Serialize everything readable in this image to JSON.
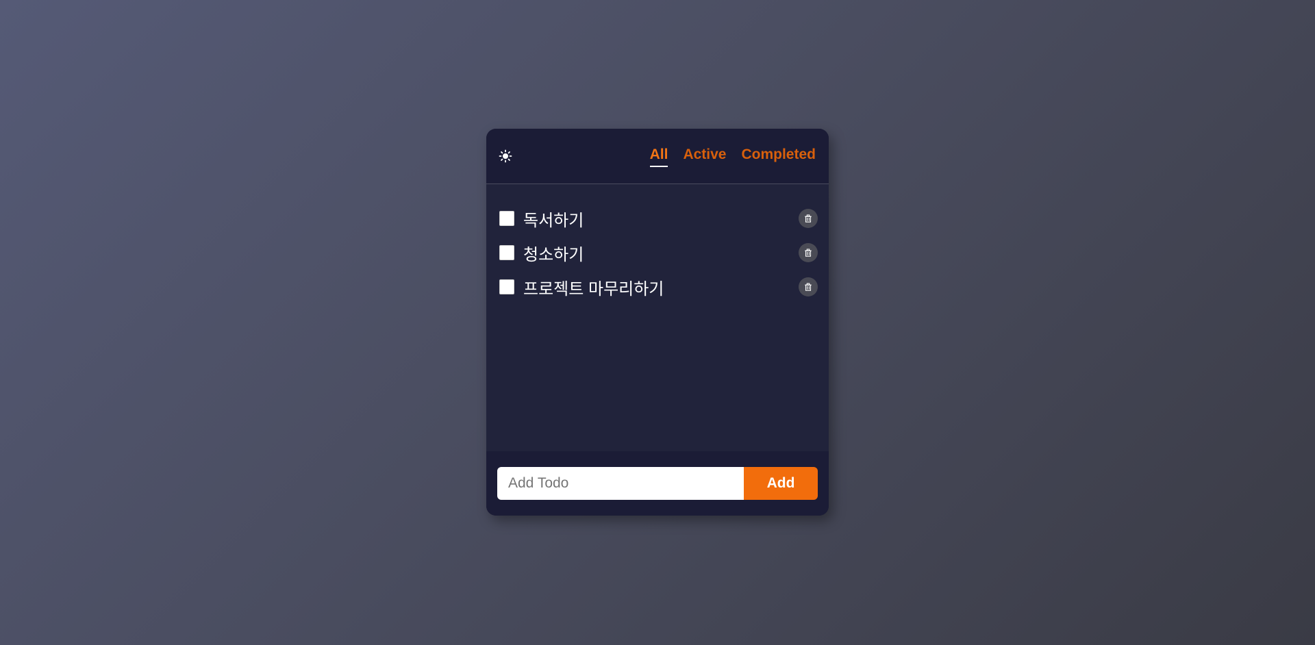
{
  "header": {
    "theme_icon": "sun-icon",
    "filters": [
      {
        "label": "All",
        "selected": true
      },
      {
        "label": "Active",
        "selected": false
      },
      {
        "label": "Completed",
        "selected": false
      }
    ]
  },
  "todos": [
    {
      "text": "독서하기",
      "completed": false
    },
    {
      "text": "청소하기",
      "completed": false
    },
    {
      "text": "프로젝트 마무리하기",
      "completed": false
    }
  ],
  "footer": {
    "input_placeholder": "Add Todo",
    "input_value": "",
    "add_label": "Add"
  },
  "colors": {
    "accent": "#f26d0c",
    "filter_text": "#d8600c",
    "card_background": "#21233b",
    "header_background": "#1b1c36"
  }
}
